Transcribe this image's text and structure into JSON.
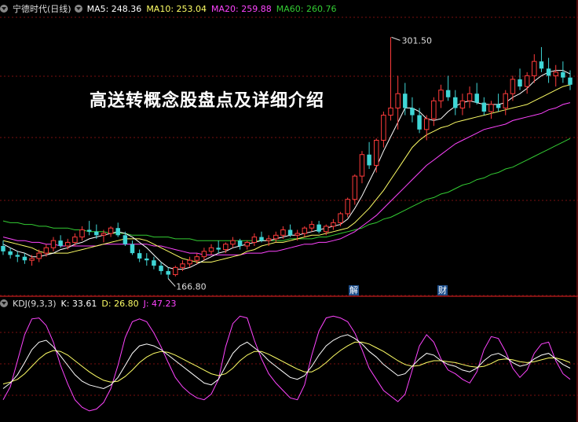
{
  "header": {
    "title": "宁德时代(日线)",
    "ma5_label": "MA5: 248.36",
    "ma10_label": "MA10: 253.04",
    "ma20_label": "MA20: 259.88",
    "ma60_label": "MA60: 260.76",
    "menu_icon": "chevron-down-icon"
  },
  "kdj_header": {
    "title": "KDJ(9,3,3)",
    "k_label": "K: 33.61",
    "d_label": "D: 26.80",
    "j_label": "J: 47.23"
  },
  "overlay_title": "高送转概念股盘点及详细介绍",
  "events": [
    "解",
    "财"
  ],
  "colors": {
    "up": "#ff3b3b",
    "down": "#3fd6d6",
    "ma5": "#ffffff",
    "ma10": "#ffff66",
    "ma20": "#ff44ff",
    "ma60": "#33cc33",
    "grid": "#7a1010",
    "k": "#ffffff",
    "d": "#ffff66",
    "j": "#ff44ff"
  },
  "chart_data": {
    "type": "candlestick",
    "high_annotation": "301.50",
    "low_annotation": "166.80",
    "ohlc": [
      [
        185,
        188,
        180,
        182
      ],
      [
        182,
        184,
        178,
        180
      ],
      [
        180,
        182,
        176,
        179
      ],
      [
        179,
        181,
        175,
        177
      ],
      [
        177,
        180,
        174,
        178
      ],
      [
        178,
        183,
        176,
        181
      ],
      [
        181,
        186,
        179,
        184
      ],
      [
        184,
        190,
        182,
        188
      ],
      [
        188,
        191,
        184,
        185
      ],
      [
        185,
        189,
        183,
        187
      ],
      [
        187,
        192,
        185,
        190
      ],
      [
        190,
        196,
        188,
        194
      ],
      [
        194,
        199,
        191,
        193
      ],
      [
        193,
        197,
        189,
        191
      ],
      [
        191,
        194,
        187,
        192
      ],
      [
        192,
        196,
        190,
        195
      ],
      [
        195,
        198,
        190,
        191
      ],
      [
        191,
        193,
        185,
        186
      ],
      [
        186,
        188,
        180,
        181
      ],
      [
        181,
        183,
        176,
        178
      ],
      [
        178,
        181,
        174,
        177
      ],
      [
        177,
        179,
        172,
        174
      ],
      [
        174,
        176,
        169,
        171
      ],
      [
        171,
        173,
        166.8,
        169
      ],
      [
        169,
        174,
        168,
        173
      ],
      [
        173,
        177,
        171,
        175
      ],
      [
        175,
        179,
        173,
        177
      ],
      [
        177,
        181,
        175,
        179
      ],
      [
        179,
        184,
        177,
        182
      ],
      [
        182,
        186,
        180,
        184
      ],
      [
        184,
        188,
        181,
        183
      ],
      [
        183,
        187,
        181,
        186
      ],
      [
        186,
        190,
        184,
        188
      ],
      [
        188,
        189,
        183,
        185
      ],
      [
        185,
        188,
        183,
        187
      ],
      [
        187,
        192,
        185,
        190
      ],
      [
        190,
        193,
        187,
        188
      ],
      [
        188,
        191,
        185,
        189
      ],
      [
        189,
        193,
        187,
        191
      ],
      [
        191,
        196,
        189,
        194
      ],
      [
        194,
        197,
        190,
        191
      ],
      [
        191,
        194,
        188,
        192
      ],
      [
        192,
        196,
        190,
        195
      ],
      [
        195,
        199,
        193,
        197
      ],
      [
        197,
        199,
        192,
        193
      ],
      [
        193,
        197,
        191,
        196
      ],
      [
        196,
        200,
        194,
        198
      ],
      [
        198,
        204,
        196,
        203
      ],
      [
        203,
        212,
        201,
        211
      ],
      [
        211,
        225,
        208,
        224
      ],
      [
        224,
        238,
        220,
        236
      ],
      [
        236,
        243,
        228,
        230
      ],
      [
        230,
        245,
        226,
        244
      ],
      [
        244,
        260,
        240,
        258
      ],
      [
        258,
        301.5,
        255,
        262
      ],
      [
        262,
        280,
        250,
        270
      ],
      [
        270,
        276,
        258,
        262
      ],
      [
        262,
        268,
        254,
        258
      ],
      [
        258,
        262,
        248,
        250
      ],
      [
        250,
        258,
        244,
        256
      ],
      [
        256,
        268,
        252,
        266
      ],
      [
        266,
        275,
        262,
        272
      ],
      [
        272,
        280,
        266,
        268
      ],
      [
        268,
        272,
        258,
        262
      ],
      [
        262,
        270,
        258,
        266
      ],
      [
        266,
        274,
        262,
        270
      ],
      [
        270,
        276,
        264,
        265
      ],
      [
        265,
        268,
        258,
        260
      ],
      [
        260,
        266,
        256,
        264
      ],
      [
        264,
        270,
        260,
        262
      ],
      [
        262,
        272,
        258,
        270
      ],
      [
        270,
        280,
        266,
        278
      ],
      [
        278,
        284,
        272,
        274
      ],
      [
        274,
        282,
        270,
        280
      ],
      [
        280,
        292,
        276,
        288
      ],
      [
        288,
        296,
        282,
        284
      ],
      [
        284,
        290,
        276,
        280
      ],
      [
        280,
        286,
        274,
        282
      ],
      [
        282,
        288,
        276,
        279
      ],
      [
        279,
        283,
        272,
        275
      ]
    ],
    "ma5": [
      186,
      184,
      182,
      181,
      179,
      179,
      180,
      181,
      183,
      184,
      186,
      187,
      189,
      190,
      191,
      192,
      193,
      192,
      190,
      187,
      184,
      180,
      176,
      173,
      172,
      172,
      173,
      175,
      177,
      179,
      181,
      182,
      184,
      185,
      186,
      187,
      188,
      188,
      189,
      190,
      191,
      191,
      192,
      193,
      194,
      195,
      196,
      197,
      200,
      206,
      213,
      221,
      229,
      238,
      246,
      254,
      262,
      262,
      260,
      256,
      255,
      256,
      260,
      263,
      265,
      266,
      265,
      264,
      264,
      264,
      265,
      268,
      270,
      273,
      277,
      280,
      282,
      283,
      283,
      281
    ],
    "ma10": [
      188,
      187,
      186,
      185,
      184,
      182,
      181,
      181,
      181,
      181,
      182,
      183,
      184,
      185,
      186,
      187,
      188,
      189,
      189,
      189,
      188,
      186,
      184,
      182,
      180,
      178,
      177,
      176,
      176,
      176,
      177,
      178,
      179,
      180,
      182,
      183,
      185,
      186,
      187,
      187,
      188,
      189,
      190,
      191,
      191,
      192,
      193,
      194,
      195,
      198,
      202,
      206,
      211,
      216,
      222,
      228,
      234,
      240,
      244,
      247,
      249,
      251,
      252,
      254,
      255,
      256,
      257,
      258,
      259,
      260,
      261,
      262,
      263,
      264,
      266,
      268,
      270,
      272,
      274,
      275
    ],
    "ma20": [
      190,
      189,
      188,
      188,
      187,
      187,
      186,
      186,
      185,
      185,
      185,
      185,
      185,
      185,
      186,
      186,
      186,
      186,
      186,
      186,
      186,
      185,
      185,
      184,
      183,
      182,
      181,
      181,
      180,
      180,
      180,
      180,
      180,
      180,
      181,
      181,
      181,
      182,
      182,
      183,
      184,
      185,
      186,
      186,
      187,
      187,
      188,
      189,
      191,
      193,
      196,
      199,
      202,
      206,
      210,
      214,
      218,
      222,
      226,
      230,
      233,
      236,
      239,
      242,
      244,
      246,
      248,
      250,
      251,
      252,
      253,
      255,
      256,
      257,
      258,
      259,
      261,
      262,
      264,
      265
    ],
    "ma60": [
      199,
      198,
      198,
      197,
      197,
      196,
      196,
      195,
      195,
      195,
      194,
      194,
      193,
      193,
      193,
      192,
      192,
      192,
      191,
      191,
      191,
      190,
      190,
      190,
      189,
      189,
      189,
      188,
      188,
      188,
      188,
      188,
      188,
      188,
      188,
      188,
      188,
      188,
      188,
      188,
      189,
      189,
      189,
      189,
      190,
      190,
      191,
      192,
      193,
      194,
      195,
      197,
      198,
      200,
      201,
      203,
      205,
      207,
      209,
      211,
      212,
      214,
      215,
      217,
      219,
      220,
      222,
      223,
      225,
      226,
      228,
      229,
      231,
      233,
      235,
      237,
      239,
      241,
      243,
      245
    ],
    "kdj": {
      "k": [
        20,
        26,
        35,
        48,
        62,
        70,
        72,
        65,
        55,
        45,
        35,
        28,
        24,
        22,
        20,
        24,
        32,
        45,
        58,
        66,
        68,
        66,
        62,
        56,
        50,
        44,
        38,
        32,
        26,
        24,
        30,
        44,
        58,
        66,
        70,
        64,
        58,
        50,
        44,
        38,
        32,
        30,
        34,
        44,
        56,
        66,
        72,
        76,
        78,
        74,
        68,
        60,
        54,
        46,
        40,
        34,
        36,
        44,
        52,
        58,
        56,
        50,
        46,
        44,
        40,
        38,
        42,
        50,
        56,
        58,
        54,
        48,
        44,
        46,
        52,
        56,
        58,
        52,
        46,
        42
      ],
      "d": [
        25,
        27,
        30,
        36,
        44,
        52,
        58,
        61,
        60,
        56,
        50,
        44,
        38,
        33,
        29,
        27,
        28,
        33,
        40,
        48,
        54,
        58,
        60,
        59,
        56,
        52,
        48,
        44,
        40,
        36,
        34,
        36,
        42,
        50,
        56,
        60,
        60,
        57,
        53,
        49,
        45,
        41,
        38,
        38,
        42,
        48,
        55,
        61,
        66,
        70,
        70,
        68,
        64,
        60,
        55,
        50,
        46,
        44,
        45,
        48,
        50,
        50,
        49,
        48,
        46,
        44,
        43,
        44,
        47,
        51,
        52,
        51,
        49,
        48,
        49,
        51,
        53,
        53,
        51,
        48
      ],
      "j": [
        8,
        22,
        50,
        78,
        95,
        96,
        88,
        70,
        45,
        25,
        8,
        0,
        -4,
        -2,
        5,
        20,
        45,
        75,
        92,
        95,
        92,
        80,
        65,
        48,
        32,
        22,
        15,
        10,
        8,
        14,
        30,
        65,
        90,
        98,
        96,
        72,
        52,
        36,
        26,
        18,
        10,
        8,
        24,
        56,
        82,
        96,
        98,
        96,
        92,
        80,
        62,
        42,
        30,
        18,
        12,
        6,
        14,
        40,
        66,
        78,
        70,
        52,
        40,
        36,
        30,
        26,
        38,
        62,
        76,
        74,
        60,
        42,
        32,
        40,
        58,
        68,
        70,
        50,
        36,
        30
      ]
    },
    "ylim": [
      160,
      310
    ],
    "kdj_ylim": [
      -10,
      105
    ]
  }
}
